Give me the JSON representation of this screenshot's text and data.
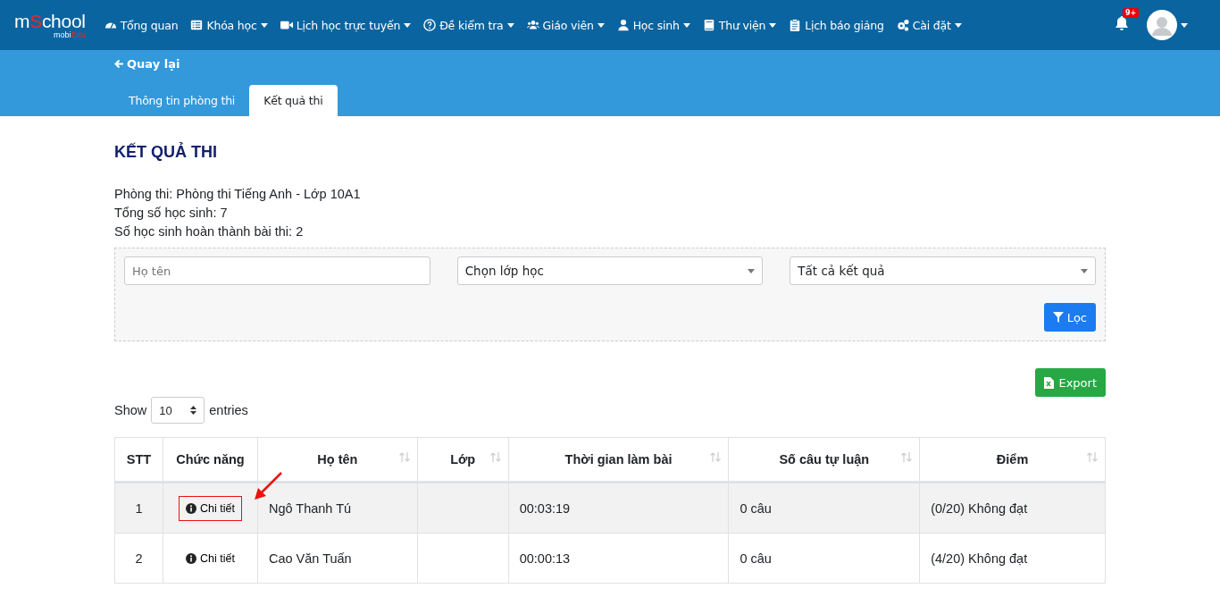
{
  "logo": {
    "main_prefix": "m",
    "main_accent": "S",
    "main_suffix": "chool",
    "sub_prefix": "mobi",
    "sub_accent": "Edu"
  },
  "nav": [
    {
      "kind": "gauge",
      "label": "Tổng quan",
      "dropdown": false
    },
    {
      "kind": "list",
      "label": "Khóa học",
      "dropdown": true
    },
    {
      "kind": "video",
      "label": "Lịch học trực tuyến",
      "dropdown": true
    },
    {
      "kind": "question",
      "label": "Đề kiểm tra",
      "dropdown": true
    },
    {
      "kind": "users",
      "label": "Giáo viên",
      "dropdown": true
    },
    {
      "kind": "user",
      "label": "Học sinh",
      "dropdown": true
    },
    {
      "kind": "book",
      "label": "Thư viện",
      "dropdown": true
    },
    {
      "kind": "clipboard",
      "label": "Lịch báo giảng",
      "dropdown": false
    },
    {
      "kind": "gears",
      "label": "Cài đặt",
      "dropdown": true
    }
  ],
  "notifications": {
    "badge": "9+"
  },
  "back_link": "Quay lại",
  "tabs": [
    {
      "label": "Thông tin phòng thi",
      "selected": false
    },
    {
      "label": "Kết quả thi",
      "selected": true
    }
  ],
  "heading": "KẾT QUẢ THI",
  "info": [
    "Phòng thi: Phòng thi Tiếng Anh - Lớp 10A1",
    "Tổng số học sinh: 7",
    "Số học sinh hoàn thành bài thi: 2"
  ],
  "filters": {
    "name": {
      "placeholder": "Họ tên"
    },
    "class_select": "Chọn lớp học",
    "result_select": "Tất cả kết quả",
    "button": "Lọc"
  },
  "export_button": "Export",
  "length": {
    "before": "Show",
    "value": "10",
    "after": "entries"
  },
  "table": {
    "columns": [
      {
        "label": "STT",
        "sortable": false
      },
      {
        "label": "Chức năng",
        "sortable": false
      },
      {
        "label": "Họ tên",
        "sortable": true
      },
      {
        "label": "Lớp",
        "sortable": true
      },
      {
        "label": "Thời gian làm bài",
        "sortable": true
      },
      {
        "label": "Số câu tự luận",
        "sortable": true
      },
      {
        "label": "Điểm",
        "sortable": true
      }
    ],
    "rows": [
      {
        "stt": "1",
        "action": "Chi tiết",
        "highlighted": true,
        "name": "Ngô Thanh Tú",
        "class": "",
        "time": "00:03:19",
        "essay": "0 câu",
        "score": "(0/20) Không đạt"
      },
      {
        "stt": "2",
        "action": "Chi tiết",
        "highlighted": false,
        "name": "Cao Văn Tuấn",
        "class": "",
        "time": "00:00:13",
        "essay": "0 câu",
        "score": "(4/20) Không đạt"
      }
    ]
  }
}
